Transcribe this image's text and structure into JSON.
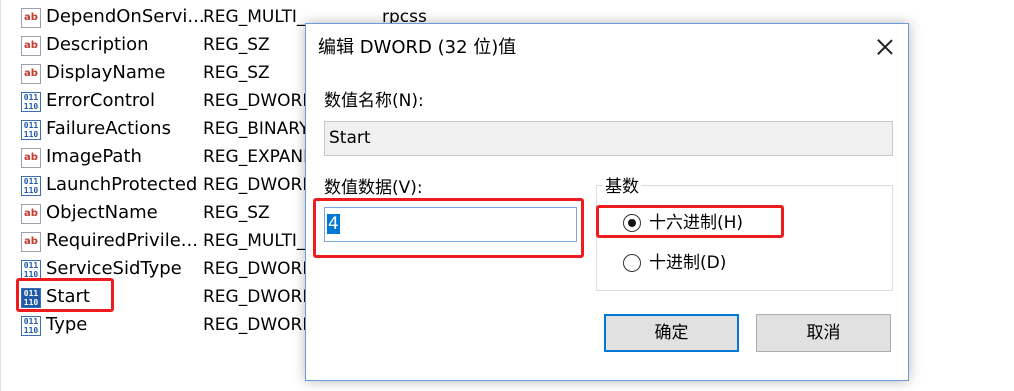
{
  "registry_list": {
    "rows": [
      {
        "name": "DependOnServi...",
        "type": "REG_MULTI_SZ",
        "data": "rpcss",
        "icon": "string-value-icon"
      },
      {
        "name": "Description",
        "type": "REG_SZ",
        "data": "",
        "icon": "string-value-icon"
      },
      {
        "name": "DisplayName",
        "type": "REG_SZ",
        "data": "",
        "icon": "string-value-icon"
      },
      {
        "name": "ErrorControl",
        "type": "REG_DWORD",
        "data": "",
        "icon": "binary-value-icon"
      },
      {
        "name": "FailureActions",
        "type": "REG_BINARY",
        "data": "",
        "icon": "binary-value-icon"
      },
      {
        "name": "ImagePath",
        "type": "REG_EXPAND_SZ",
        "data": "",
        "icon": "string-value-icon"
      },
      {
        "name": "LaunchProtected",
        "type": "REG_DWORD",
        "data": "",
        "icon": "binary-value-icon"
      },
      {
        "name": "ObjectName",
        "type": "REG_SZ",
        "data": "",
        "icon": "string-value-icon"
      },
      {
        "name": "RequiredPrivile...",
        "type": "REG_MULTI_SZ",
        "data": "",
        "icon": "string-value-icon"
      },
      {
        "name": "ServiceSidType",
        "type": "REG_DWORD",
        "data": "",
        "icon": "binary-value-icon"
      },
      {
        "name": "Start",
        "type": "REG_DWORD",
        "data": "",
        "icon": "binary-value-icon",
        "selected": true
      },
      {
        "name": "Type",
        "type": "REG_DWORD",
        "data": "",
        "icon": "binary-value-icon"
      }
    ],
    "icon_text": {
      "string": "ab",
      "binary": "011 110"
    }
  },
  "dialog": {
    "title": "编辑 DWORD (32 位)值",
    "value_name_label": "数值名称(N):",
    "value_name": "Start",
    "value_data_label": "数值数据(V):",
    "value_data": "4",
    "base_group_label": "基数",
    "radio_hex_label": "十六进制(H)",
    "radio_dec_label": "十进制(D)",
    "selected_base": "hex",
    "ok_label": "确定",
    "cancel_label": "取消"
  },
  "colors": {
    "highlight_red": "#ee1c1c",
    "selection_blue": "#0078d7",
    "dialog_border": "#6b9bd6"
  }
}
